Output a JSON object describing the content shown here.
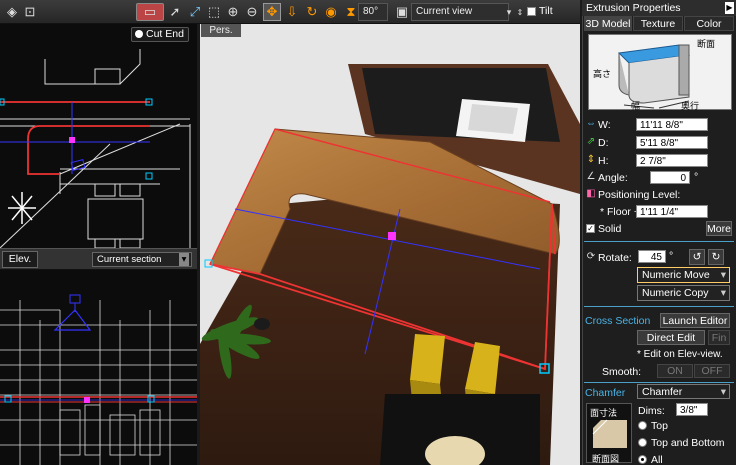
{
  "toolbar": {
    "angle_value": "80°",
    "view_select": "Current view",
    "tilt_label": "Tilt"
  },
  "plan_view": {
    "cut_end_label": "Cut End"
  },
  "elev_view": {
    "tab_label": "Elev.",
    "section_select": "Current section"
  },
  "view3d": {
    "tab_label": "Pers."
  },
  "panel": {
    "title": "Extrusion Properties",
    "tabs": [
      "3D Model",
      "Texture",
      "Color"
    ],
    "preview_labels": {
      "section": "断面",
      "height": "高さ",
      "width": "幅",
      "depth": "奥行"
    },
    "dims": {
      "w_label": "W:",
      "w_value": "11'11 8/8\"",
      "d_label": "D:",
      "d_value": "5'11 8/8\"",
      "h_label": "H:",
      "h_value": "2 7/8\"",
      "angle_label": "Angle:",
      "angle_value": "0",
      "angle_unit": "°"
    },
    "positioning_label": "Positioning Level:",
    "floor_label": "* Floor +",
    "floor_value": "1'11 1/4\"",
    "solid_label": "Solid",
    "more_label": "More",
    "rotate_label": "Rotate:",
    "rotate_value": "45",
    "rotate_unit": "°",
    "numeric_move": "Numeric Move",
    "numeric_copy": "Numeric Copy",
    "cross_section_label": "Cross Section",
    "launch_editor_label": "Launch Editor",
    "direct_edit_label": "Direct Edit",
    "fin_label": "Fin",
    "edit_note": "* Edit on Elev-view.",
    "smooth_label": "Smooth:",
    "smooth_on": "ON",
    "smooth_off": "OFF",
    "chamfer_label": "Chamfer",
    "chamfer_select": "Chamfer",
    "dims_label": "Dims:",
    "dims_value": "3/8\"",
    "chamfer_preview_top": "面寸法",
    "chamfer_preview_bottom": "断面図",
    "radio_top": "Top",
    "radio_top_bottom": "Top and Bottom",
    "radio_all": "All"
  }
}
